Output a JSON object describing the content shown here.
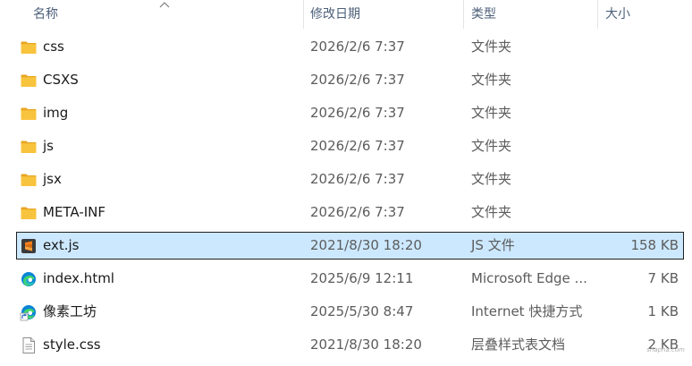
{
  "columns": {
    "name": "名称",
    "modified": "修改日期",
    "type": "类型",
    "size": "大小"
  },
  "files": [
    {
      "name": "css",
      "modified": "2026/2/6 7:37",
      "type": "文件夹",
      "size": "",
      "icon": "folder-icon"
    },
    {
      "name": "CSXS",
      "modified": "2026/2/6 7:37",
      "type": "文件夹",
      "size": "",
      "icon": "folder-icon"
    },
    {
      "name": "img",
      "modified": "2026/2/6 7:37",
      "type": "文件夹",
      "size": "",
      "icon": "folder-icon"
    },
    {
      "name": "js",
      "modified": "2026/2/6 7:37",
      "type": "文件夹",
      "size": "",
      "icon": "folder-icon"
    },
    {
      "name": "jsx",
      "modified": "2026/2/6 7:37",
      "type": "文件夹",
      "size": "",
      "icon": "folder-icon"
    },
    {
      "name": "META-INF",
      "modified": "2026/2/6 7:37",
      "type": "文件夹",
      "size": "",
      "icon": "folder-icon"
    },
    {
      "name": "ext.js",
      "modified": "2021/8/30 18:20",
      "type": "JS 文件",
      "size": "158 KB",
      "icon": "sublime-file-icon",
      "selected": true
    },
    {
      "name": "index.html",
      "modified": "2025/6/9 12:11",
      "type": "Microsoft Edge ...",
      "size": "7 KB",
      "icon": "edge-icon"
    },
    {
      "name": "像素工坊",
      "modified": "2025/5/30 8:47",
      "type": "Internet 快捷方式",
      "size": "1 KB",
      "icon": "edge-shortcut-icon"
    },
    {
      "name": "style.css",
      "modified": "2021/8/30 18:20",
      "type": "层叠样式表文档",
      "size": "2 KB",
      "icon": "text-file-icon"
    }
  ],
  "watermark": "shapha.com",
  "colors": {
    "header_text": "#4c607a",
    "selection_bg": "#cce8ff",
    "selection_border": "#1f1f1f",
    "folder": "#f8c43e",
    "sublime": "#f57f17",
    "edge": "#0a84d6"
  }
}
